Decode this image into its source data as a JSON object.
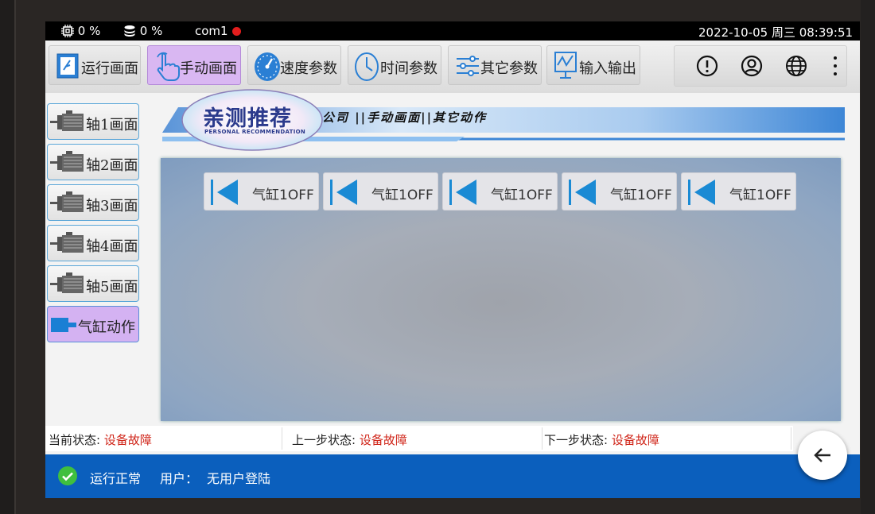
{
  "status_bar": {
    "cpu": "0 %",
    "storage": "0 %",
    "port": "com1",
    "datetime": "2022-10-05 周三 08:39:51",
    "port_status_color": "#e21d1d"
  },
  "toolbar": {
    "tabs": [
      {
        "label": "运行画面",
        "icon": "run-screen-icon"
      },
      {
        "label": "手动画面",
        "icon": "hand-pointer-icon",
        "active": true
      },
      {
        "label": "速度参数",
        "icon": "gauge-icon"
      },
      {
        "label": "时间参数",
        "icon": "clock-icon"
      },
      {
        "label": "其它参数",
        "icon": "sliders-icon"
      },
      {
        "label": "输入输出",
        "icon": "chart-icon"
      }
    ],
    "right_icons": [
      "alert-icon",
      "user-icon",
      "globe-icon",
      "more-vertical-icon"
    ]
  },
  "sidebar": {
    "items": [
      {
        "label": "轴1画面",
        "icon": "motor-icon"
      },
      {
        "label": "轴2画面",
        "icon": "motor-icon"
      },
      {
        "label": "轴3画面",
        "icon": "motor-icon"
      },
      {
        "label": "轴4画面",
        "icon": "motor-icon"
      },
      {
        "label": "轴5画面",
        "icon": "motor-icon"
      },
      {
        "label": "气缸动作",
        "icon": "cylinder-icon",
        "active": true
      }
    ]
  },
  "header": {
    "breadcrumb": "公司 ||手动画面||其它动作",
    "stamp_title": "亲测推荐",
    "stamp_subtitle": "PERSONAL RECOMMENDATION"
  },
  "cylinders": [
    {
      "label": "气缸1OFF"
    },
    {
      "label": "气缸1OFF"
    },
    {
      "label": "气缸1OFF"
    },
    {
      "label": "气缸1OFF"
    },
    {
      "label": "气缸1OFF"
    }
  ],
  "state": {
    "current_label": "当前状态:",
    "current_value": "设备故障",
    "prev_label": "上一步状态:",
    "prev_value": "设备故障",
    "next_label": "下一步状态:",
    "next_value": "设备故障"
  },
  "bottom_bar": {
    "status": "运行正常",
    "user_label": "用户：",
    "user_value": "无用户登陆"
  },
  "colors": {
    "accent": "#0b5fbd",
    "active_tab": "#d9b7f2",
    "error_text": "#d0261a",
    "ok": "#3fbf3f"
  }
}
